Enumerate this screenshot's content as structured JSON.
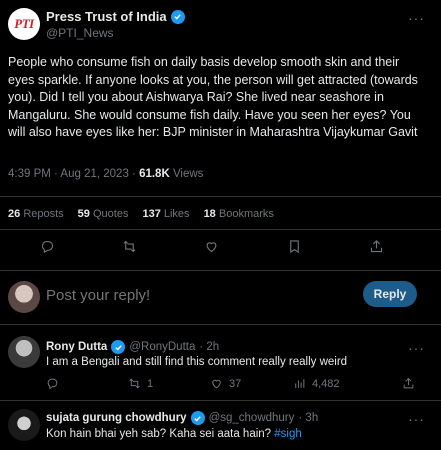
{
  "tweet": {
    "author_name": "Press Trust of India",
    "author_handle": "@PTI_News",
    "logo_text": "PTI",
    "body": "People who consume fish on daily basis develop smooth skin and their eyes sparkle. If anyone looks at you, the person will get attracted (towards you). Did I tell you about Aishwarya Rai? She lived near seashore in Mangaluru. She would consume fish daily. Have you seen her eyes? You will also have eyes like her: BJP minister in Maharashtra Vijaykumar Gavit",
    "time": "4:39 PM · Aug 21, 2023 · ",
    "views_count": "61.8K",
    "views_label": " Views",
    "stats": {
      "reposts_count": "26",
      "reposts_label": "Reposts",
      "quotes_count": "59",
      "quotes_label": "Quotes",
      "likes_count": "137",
      "likes_label": "Likes",
      "bookmarks_count": "18",
      "bookmarks_label": "Bookmarks"
    },
    "more_label": "···"
  },
  "composer": {
    "placeholder": "Post your reply!",
    "button_label": "Reply"
  },
  "replies": [
    {
      "name": "Rony Dutta",
      "handle": "@RonyDutta",
      "time": "· 2h",
      "text": "I am a Bengali and still find this comment really really weird",
      "reposts": "1",
      "likes": "37",
      "views": "4,482",
      "more_label": "···"
    },
    {
      "name": "sujata gurung chowdhury",
      "handle": "@sg_chowdhury",
      "time": "· 3h",
      "text": "Kon hain bhai yeh sab? Kaha sei aata hain? ",
      "hashtag": "#sigh",
      "more_label": "···"
    }
  ],
  "colors": {
    "background": "#000000",
    "text": "#e7e9ea",
    "muted": "#71767b",
    "accent": "#1d9bf0",
    "reply_button": "#1d5b8a",
    "divider": "#2f3336"
  },
  "icons": [
    "verified-badge-icon",
    "more-icon",
    "reply-icon",
    "repost-icon",
    "like-icon",
    "bookmark-icon",
    "share-icon",
    "views-icon"
  ]
}
